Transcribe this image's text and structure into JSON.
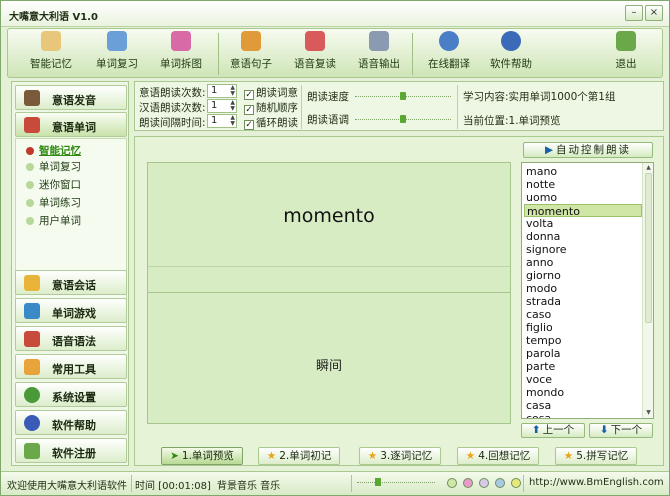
{
  "window": {
    "title": "大嘴意大利语  V1.0",
    "minimize_glyph": "–",
    "close_glyph": "×"
  },
  "toolbar": [
    {
      "label": "智能记忆",
      "icon": "book-icon",
      "color": "#e8c77a"
    },
    {
      "label": "单词复习",
      "icon": "flag-icon",
      "color": "#6a9fd8"
    },
    {
      "label": "单词拆图",
      "icon": "grid-icon",
      "color": "#d86aa8"
    },
    {
      "label": "意语句子",
      "icon": "people-icon",
      "color": "#e09a3a"
    },
    {
      "label": "语音复读",
      "icon": "speaker-person-icon",
      "color": "#d85a5a"
    },
    {
      "label": "语音输出",
      "icon": "satellite-icon",
      "color": "#8a9ab0"
    },
    {
      "label": "在线翻译",
      "icon": "refresh-globe-icon",
      "color": "#4a7fc8"
    },
    {
      "label": "软件帮助",
      "icon": "help-icon",
      "color": "#3a6ab8"
    },
    {
      "label": "退出",
      "icon": "exit-door-icon",
      "color": "#6aa84a"
    }
  ],
  "sidebar": {
    "top_items": [
      {
        "label": "意语发音",
        "icon": "speaker-icon",
        "color": "#7a5a3a"
      },
      {
        "label": "意语单词",
        "icon": "book-stack-icon",
        "color": "#c84a3a"
      }
    ],
    "sub_items": [
      "智能记忆",
      "单词复习",
      "迷你窗口",
      "单词练习",
      "用户单词"
    ],
    "active_sub": "智能记忆",
    "bottom_items": [
      {
        "label": "意语会话",
        "icon": "chat-icon",
        "color": "#e8b43a"
      },
      {
        "label": "单词游戏",
        "icon": "puzzle-icon",
        "color": "#3a8ac8"
      },
      {
        "label": "语音语法",
        "icon": "abc-icon",
        "color": "#c84a3a"
      },
      {
        "label": "常用工具",
        "icon": "tools-icon",
        "color": "#e8a33a"
      },
      {
        "label": "系统设置",
        "icon": "settings-icon",
        "color": "#4a9a3a"
      },
      {
        "label": "软件帮助",
        "icon": "help-icon",
        "color": "#3a5ab8"
      },
      {
        "label": "软件注册",
        "icon": "register-icon",
        "color": "#6aa84a"
      }
    ]
  },
  "settings": {
    "italian_read_times_label": "意语朗读次数:",
    "italian_read_times_value": "1",
    "chinese_read_times_label": "汉语朗读次数:",
    "chinese_read_times_value": "1",
    "read_interval_label": "朗读间隔时间:",
    "read_interval_value": "1",
    "chk_read_meaning": "朗读词意",
    "chk_random_order": "随机顺序",
    "chk_loop_read": "循环朗读",
    "read_speed_label": "朗读速度",
    "read_tone_label": "朗读语调",
    "read_speed_level": 0.5,
    "read_tone_level": 0.5,
    "study_content": "学习内容:实用单词1000个第1组",
    "current_position": "当前位置:1.单词预览"
  },
  "main": {
    "word": "momento",
    "meaning": "瞬间",
    "auto_button": "自动控制朗读",
    "words": [
      "mano",
      "notte",
      "uomo",
      "momento",
      "volta",
      "donna",
      "signore",
      "anno",
      "giorno",
      "modo",
      "strada",
      "caso",
      "figlio",
      "tempo",
      "parola",
      "parte",
      "voce",
      "mondo",
      "casa",
      "cosa"
    ],
    "selected_word": "momento",
    "prev_button": "上一个",
    "next_button": "下一个"
  },
  "steps": [
    {
      "label": "1.单词预览",
      "active": true
    },
    {
      "label": "2.单词初记",
      "active": false
    },
    {
      "label": "3.逐词记忆",
      "active": false
    },
    {
      "label": "4.回想记忆",
      "active": false
    },
    {
      "label": "5.拼写记忆",
      "active": false
    }
  ],
  "status": {
    "welcome": "欢迎使用大嘴意大利语软件",
    "time": "时间 [00:01:08]",
    "bg_music": "背景音乐 音乐",
    "music_level": 0.25,
    "url": "http://www.BmEnglish.com",
    "skin_colors": [
      "#cfe8a8",
      "#e89ac8",
      "#d8c8e8",
      "#a8c8e8",
      "#e8e878",
      "#e8a8a8"
    ]
  }
}
